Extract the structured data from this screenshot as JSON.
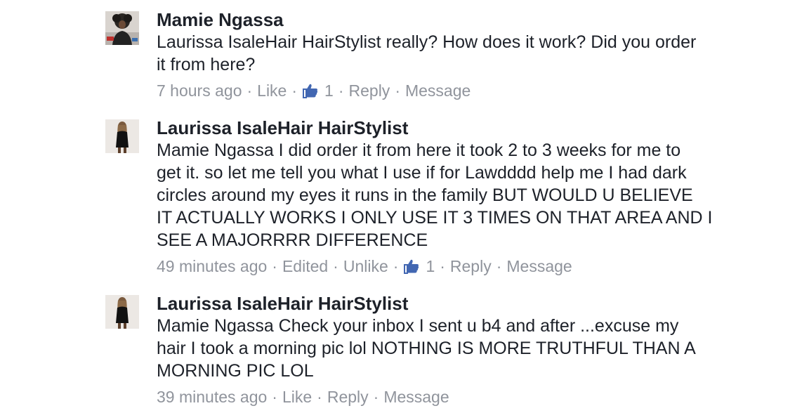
{
  "comments": [
    {
      "author": "Mamie Ngassa",
      "text": "Laurissa IsaleHair HairStylist really? How does it work? Did you order\nit from here?",
      "time": "7 hours ago",
      "like_action": "Like",
      "like_count": "1",
      "reply": "Reply",
      "message": "Message"
    },
    {
      "author": "Laurissa IsaleHair HairStylist",
      "text": "Mamie Ngassa I did order it from here it took 2 to 3 weeks for me to\nget it. so let me tell you what I use if for Lawdddd help me I had dark\ncircles around my eyes it runs in the family BUT WOULD U BELIEVE\nIT ACTUALLY WORKS I ONLY USE IT 3 TIMES ON THAT AREA AND I\nSEE A MAJORRRR DIFFERENCE",
      "time": "49 minutes ago",
      "edited": "Edited",
      "like_action": "Unlike",
      "like_count": "1",
      "reply": "Reply",
      "message": "Message"
    },
    {
      "author": "Laurissa IsaleHair HairStylist",
      "text": "Mamie Ngassa Check your inbox I sent u b4 and after ...excuse my\nhair I took a morning pic lol NOTHING IS MORE  TRUTHFUL THAN A\nMORNING PIC LOL",
      "time": "39 minutes ago",
      "like_action": "Like",
      "reply": "Reply",
      "message": "Message"
    }
  ],
  "colors": {
    "author": "#1d2129",
    "meta": "#90949c",
    "like_icon": "#4267b2"
  },
  "icons": [
    "thumbs-up-icon"
  ]
}
